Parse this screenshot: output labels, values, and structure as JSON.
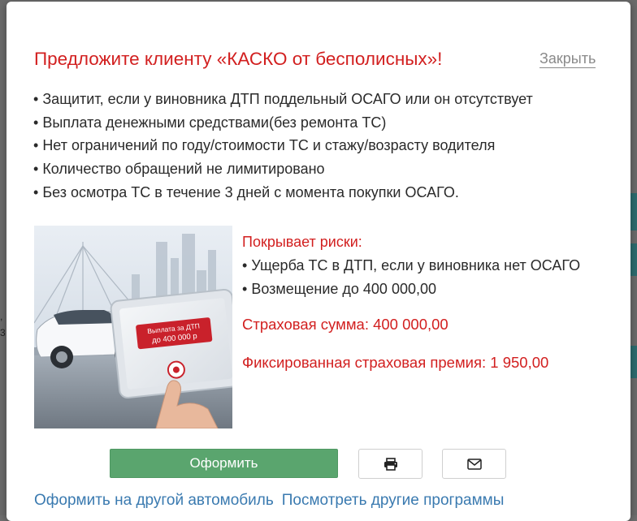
{
  "dialog": {
    "title": "Предложите клиенту «КАСКО от бесполисных»!",
    "close_label": "Закрыть",
    "benefits": [
      "Защитит, если у виновника ДТП поддельный ОСАГО или он отсутствует",
      "Выплата денежными средствами(без ремонта ТС)",
      "Нет ограничений по году/стоимости ТС и стажу/возрасту водителя",
      "Количество обращений не лимитировано",
      "Без осмотра ТС в течение 3 дней с момента покупки ОСАГО."
    ],
    "bullet": "•",
    "image": {
      "banner_line1": "Выплата за ДТП",
      "banner_line2": "до 400 000 р"
    },
    "details": {
      "risks_heading": "Покрывает риски:",
      "risks": [
        "Ущерба ТС в ДТП, если у виновника нет ОСАГО",
        "Возмещение до 400 000,00"
      ],
      "sum_insured": "Страховая сумма: 400 000,00",
      "premium": "Фиксированная страховая премия: 1 950,00"
    },
    "actions": {
      "submit_label": "Оформить",
      "print_icon": "print-icon",
      "mail_icon": "envelope-icon"
    },
    "links": {
      "other_car": "Оформить на другой автомобиль",
      "other_programs": "Посмотреть другие программы"
    }
  },
  "background": {
    "left_edge_glyphs": [
      ",",
      "3"
    ]
  },
  "colors": {
    "accent_red": "#d21f1f",
    "button_green": "#5aa56e",
    "link_blue": "#3a7ab0",
    "backdrop": "#6b6b6b"
  }
}
